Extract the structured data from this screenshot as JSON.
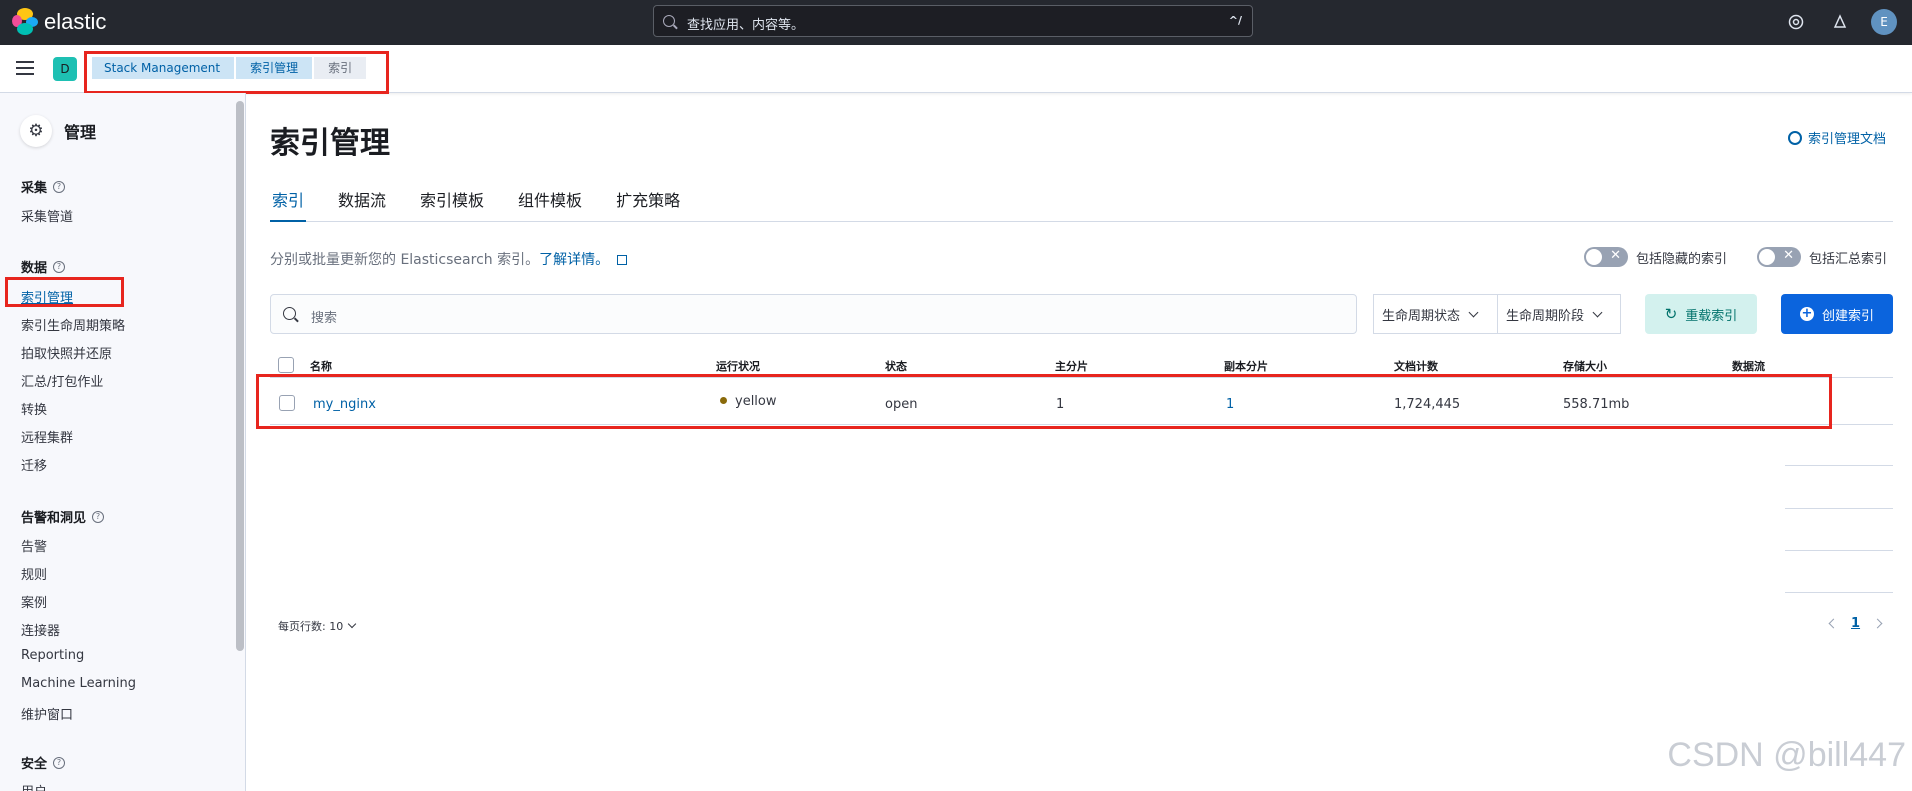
{
  "header": {
    "brand": "elastic",
    "search_placeholder": "查找应用、内容等。",
    "search_shortcut": "^/",
    "icons": [
      "help-icon",
      "news-icon"
    ],
    "user_initial": "E"
  },
  "crumbbar": {
    "space_initial": "D",
    "breadcrumbs": [
      "Stack Management",
      "索引管理",
      "索引"
    ]
  },
  "sidebar": {
    "title": "管理",
    "groups": [
      {
        "label": "采集",
        "items": [
          "采集管道"
        ]
      },
      {
        "label": "数据",
        "items": [
          "索引管理",
          "索引生命周期策略",
          "拍取快照并还原",
          "汇总/打包作业",
          "转换",
          "远程集群",
          "迁移"
        ]
      },
      {
        "label": "告警和洞见",
        "items": [
          "告警",
          "规则",
          "案例",
          "连接器",
          "Reporting",
          "Machine Learning",
          "维护窗口"
        ]
      },
      {
        "label": "安全",
        "items": [
          "用户"
        ]
      }
    ],
    "active_item": "索引管理"
  },
  "main": {
    "title": "索引管理",
    "docs_link": "索引管理文档",
    "tabs": [
      "索引",
      "数据流",
      "索引模板",
      "组件模板",
      "扩充策略"
    ],
    "active_tab": "索引",
    "description": "分别或批量更新您的 Elasticsearch 索引。",
    "learn_more": "了解详情。",
    "toggle_hidden": "包括隐藏的索引",
    "toggle_rollup": "包括汇总索引",
    "search_placeholder": "搜索",
    "filter_lifecycle_status": "生命周期状态",
    "filter_lifecycle_phase": "生命周期阶段",
    "reload_button": "重载索引",
    "create_button": "创建索引",
    "columns": [
      "名称",
      "运行状况",
      "状态",
      "主分片",
      "副本分片",
      "文档计数",
      "存储大小",
      "数据流"
    ],
    "rows": [
      {
        "name": "my_nginx",
        "health": "yellow",
        "status": "open",
        "primaries": "1",
        "replicas": "1",
        "docs": "1,724,445",
        "size": "558.71mb",
        "data_stream": ""
      }
    ],
    "rows_per_page": "每页行数: 10",
    "current_page": "1"
  },
  "watermark": "CSDN @bill447",
  "colors": {
    "accent": "#0061a6",
    "header_bg": "#25282f",
    "highlight_red": "#e7251e",
    "health_yellow": "#8a6a0a"
  }
}
